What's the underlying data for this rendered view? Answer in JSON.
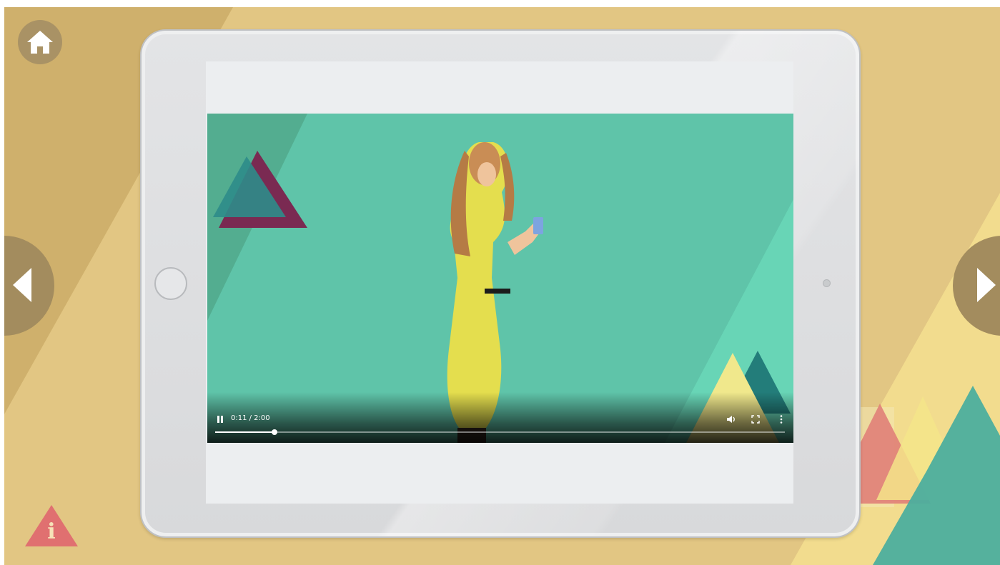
{
  "app": {
    "home_icon": "home-icon",
    "prev_icon": "chevron-left-icon",
    "next_icon": "chevron-right-icon",
    "info_label": "i"
  },
  "player": {
    "time_display": "0:11 / 2:00",
    "progress": 0.104,
    "state": "playing",
    "icons": [
      "pause-icon",
      "volume-icon",
      "fullscreen-icon",
      "more-options-icon"
    ]
  },
  "colors": {
    "background": "#e2c683",
    "nav_buttons": "#a38c5e",
    "video_background": "#5fc4a9",
    "info_triangle": "#e07070",
    "accent_teal": "#4cae9e",
    "accent_yellow": "#f5e58a"
  }
}
